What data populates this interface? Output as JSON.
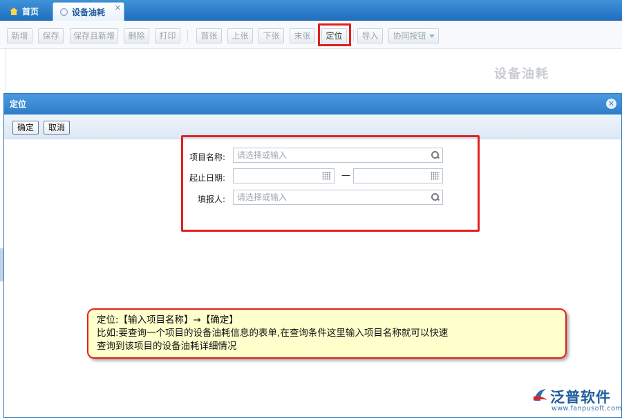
{
  "tabs": {
    "home": "首页",
    "active": "设备油耗",
    "close": "✕"
  },
  "toolbar": {
    "buttons": [
      "新增",
      "保存",
      "保存且新增",
      "删除",
      "打印",
      "首张",
      "上张",
      "下张",
      "末张",
      "定位",
      "导入",
      "协同按钮"
    ]
  },
  "page": {
    "title": "设备油耗"
  },
  "dialog": {
    "title": "定位",
    "close": "✕",
    "ok": "确定",
    "cancel": "取消"
  },
  "form": {
    "project_label": "项目名称:",
    "project_placeholder": "请选择或输入",
    "date_label": "起止日期:",
    "date_separator": "—",
    "reporter_label": "填报人:",
    "reporter_placeholder": "请选择或输入"
  },
  "callout": {
    "line1": "定位:【输入项目名称】→【确定】",
    "line2": "比如:要查询一个项目的设备油耗信息的表单,在查询条件这里输入项目名称就可以快速",
    "line3": "查询到该项目的设备油耗详细情况"
  },
  "logo": {
    "name": "泛普软件",
    "url": "www.fanpusoft.com"
  }
}
